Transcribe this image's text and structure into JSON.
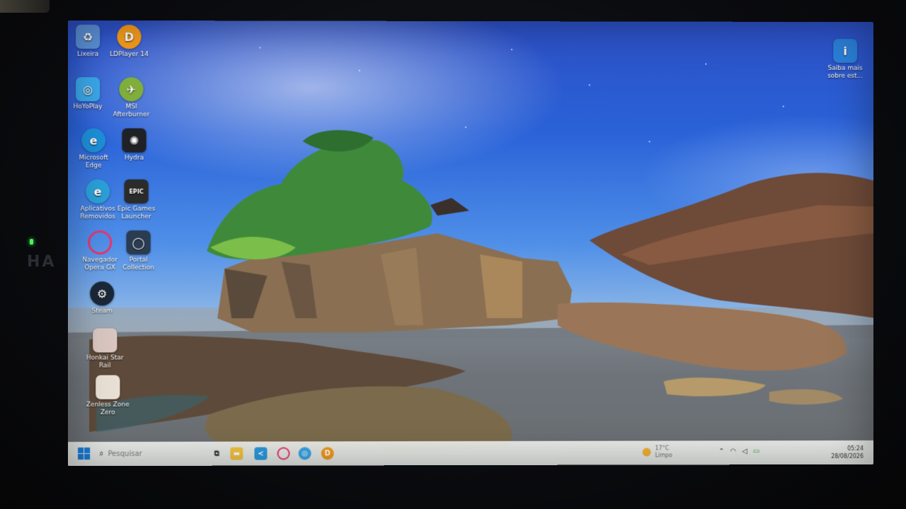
{
  "desktop": {
    "icons": [
      {
        "label": "Lixeira",
        "icon": "recycle-bin-icon",
        "color": "#5a8fd6"
      },
      {
        "label": "LDPlayer 14",
        "icon": "ldplayer-icon",
        "color": "#f39a1c"
      },
      {
        "label": "HoYoPlay",
        "icon": "hoyoplay-icon",
        "color": "#3aa6e8"
      },
      {
        "label": "MSI Afterburner",
        "icon": "msi-afterburner-icon",
        "color": "#7fae3b"
      },
      {
        "label": "Microsoft Edge",
        "icon": "edge-icon",
        "color": "#1d8fd8"
      },
      {
        "label": "Hydra",
        "icon": "hydra-icon",
        "color": "#1f2126"
      },
      {
        "label": "Aplicativos Removidos",
        "icon": "edge-icon",
        "color": "#2aa0d9"
      },
      {
        "label": "Epic Games Launcher",
        "icon": "epic-games-icon",
        "color": "#2b2b2b"
      },
      {
        "label": "Navegador Opera GX",
        "icon": "opera-gx-icon",
        "color": "#e8356e"
      },
      {
        "label": "Portal Collection",
        "icon": "portal-icon",
        "color": "#2a3c52"
      },
      {
        "label": "Steam",
        "icon": "steam-icon",
        "color": "#1b2838"
      },
      {
        "label": "Honkai Star Rail",
        "icon": "honkai-star-rail-icon",
        "color": "#d9c6c0"
      },
      {
        "label": "Zenless Zone Zero",
        "icon": "zenless-zone-zero-icon",
        "color": "#e8e0d4"
      }
    ],
    "spotlight": {
      "label": "Saiba mais sobre est...",
      "icon": "spotlight-info-icon",
      "color": "#2a7fd8"
    }
  },
  "taskbar": {
    "search_placeholder": "Pesquisar",
    "apps": [
      {
        "icon": "file-explorer-icon",
        "color": "#f3c443"
      },
      {
        "icon": "vscode-icon",
        "color": "#2b9be0"
      },
      {
        "icon": "opera-gx-icon",
        "color": "#e8356e"
      },
      {
        "icon": "hoyoplay-icon",
        "color": "#3aa6e8"
      },
      {
        "icon": "ldplayer-icon",
        "color": "#f39a1c"
      }
    ],
    "weather": {
      "temp": "17°C",
      "condition": "Limpo"
    },
    "clock": {
      "time": "05:24",
      "date": "28/08/2026"
    }
  },
  "colors": {
    "accent": "#1a7fdc",
    "taskbar_bg": "#eef0ec"
  }
}
